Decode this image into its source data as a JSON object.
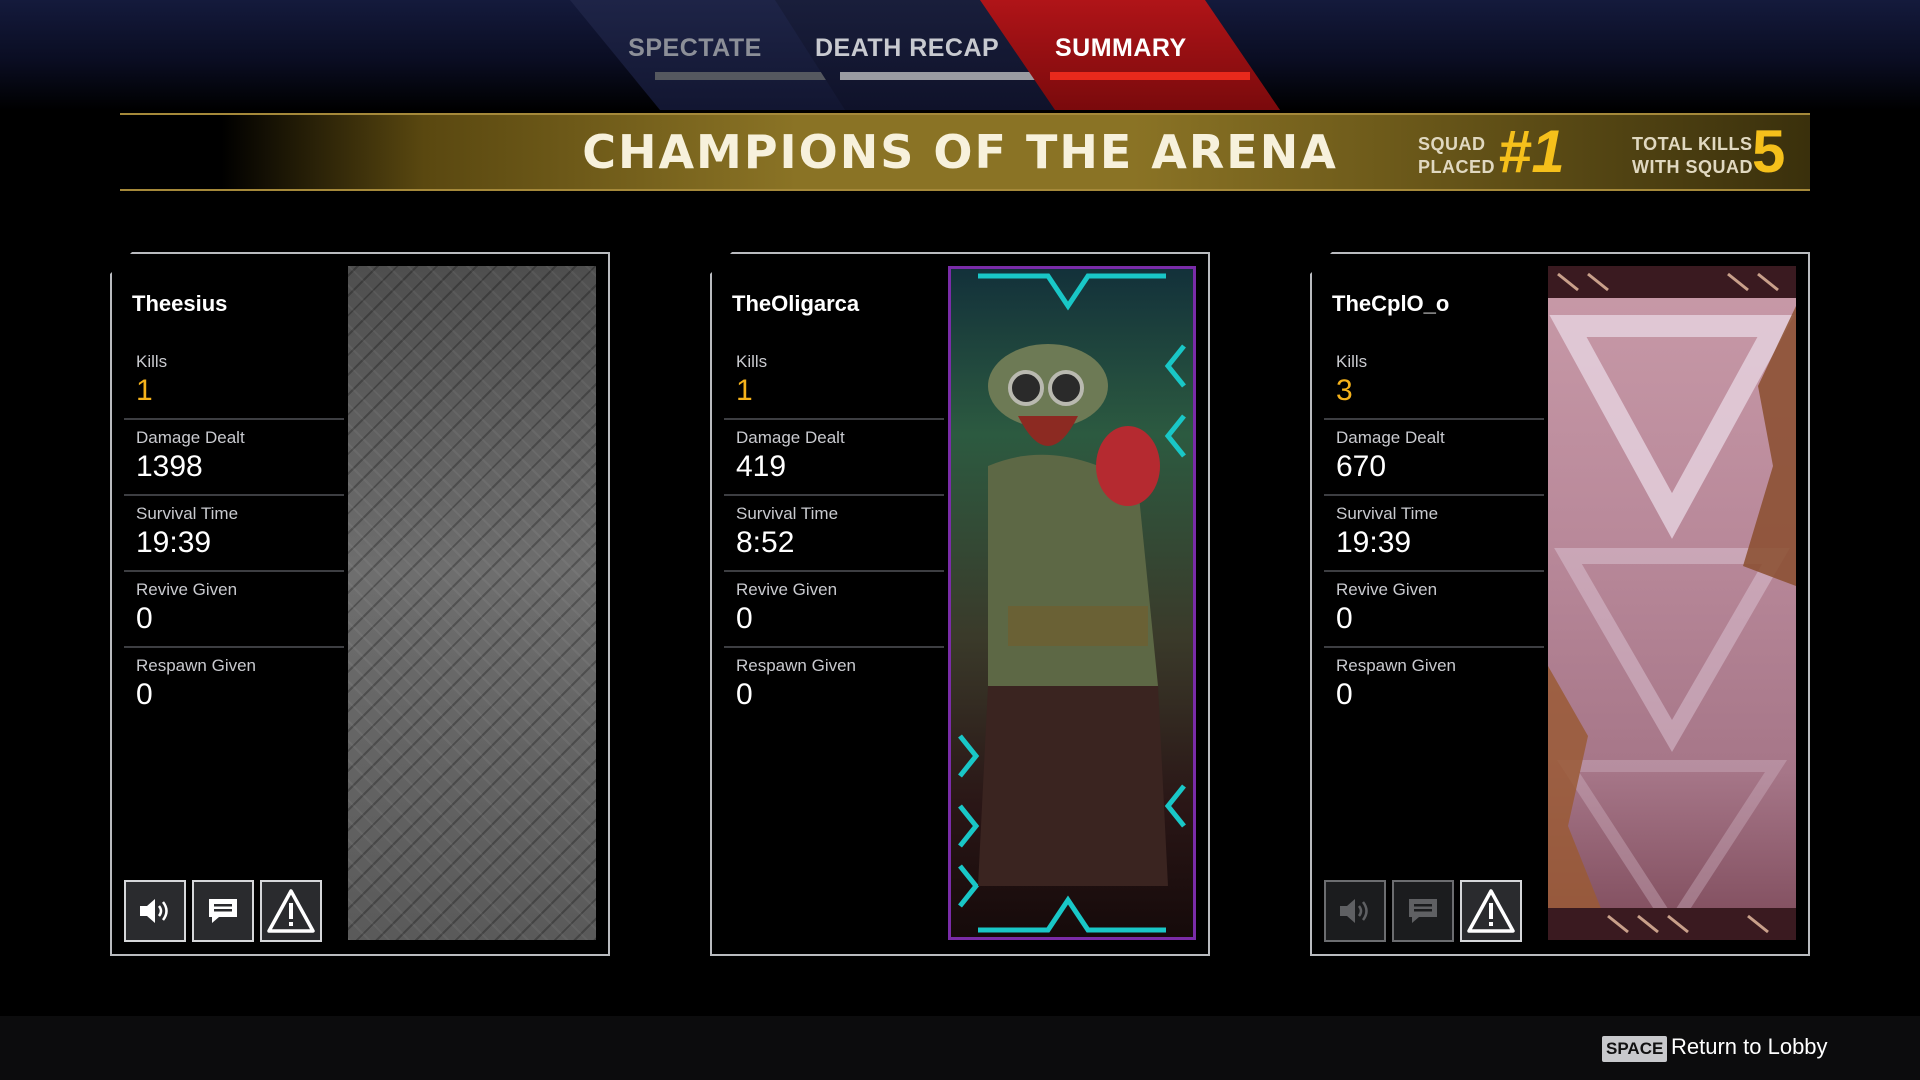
{
  "tabs": [
    {
      "label": "SPECTATE",
      "state": "inactive"
    },
    {
      "label": "DEATH RECAP",
      "state": "inactive"
    },
    {
      "label": "SUMMARY",
      "state": "active"
    }
  ],
  "banner": {
    "title": "CHAMPIONS OF THE ARENA",
    "squad_placed_label_1": "SQUAD",
    "squad_placed_label_2": "PLACED",
    "squad_placed_value": "#1",
    "total_kills_label_1": "TOTAL KILLS",
    "total_kills_label_2": "WITH SQUAD",
    "total_kills_value": "5"
  },
  "stat_labels": {
    "kills": "Kills",
    "damage": "Damage Dealt",
    "survival": "Survival Time",
    "revive": "Revive Given",
    "respawn": "Respawn Given"
  },
  "players": [
    {
      "name": "Theesius",
      "kills": "1",
      "damage": "1398",
      "survival": "19:39",
      "revive": "0",
      "respawn": "0",
      "banner_style": "metal-plate",
      "actions_enabled": true
    },
    {
      "name": "TheOligarca",
      "kills": "1",
      "damage": "419",
      "survival": "8:52",
      "revive": "0",
      "respawn": "0",
      "banner_style": "bloodhound-art",
      "actions_enabled": false
    },
    {
      "name": "TheCplO_o",
      "kills": "3",
      "damage": "670",
      "survival": "19:39",
      "revive": "0",
      "respawn": "0",
      "banner_style": "pink-triangles",
      "actions_enabled": true
    }
  ],
  "icons": {
    "mute": "speaker-icon",
    "chat": "chat-bubble-icon",
    "report": "warning-icon"
  },
  "footer": {
    "key": "SPACE",
    "action_label": "Return to Lobby"
  },
  "colors": {
    "accent_gold": "#f5b21b",
    "active_tab": "#b01418",
    "banner_gold": "#8a7325"
  }
}
